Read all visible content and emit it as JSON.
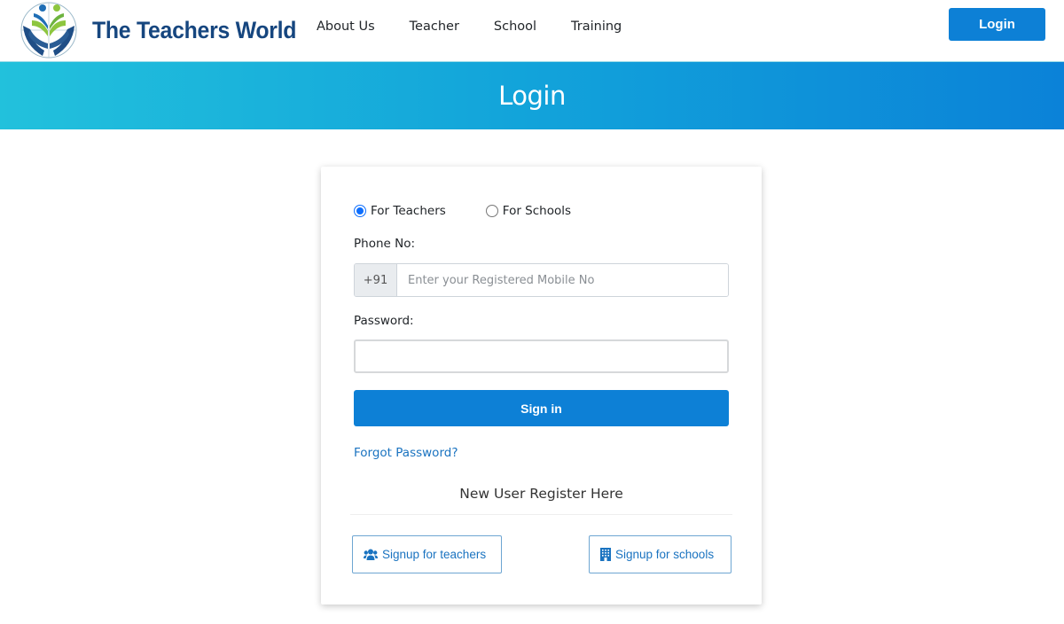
{
  "header": {
    "brand": "The Teachers World",
    "nav": [
      {
        "label": "About Us"
      },
      {
        "label": "Teacher"
      },
      {
        "label": "School"
      },
      {
        "label": "Training"
      }
    ],
    "login_label": "Login"
  },
  "banner": {
    "title": "Login"
  },
  "form": {
    "user_types": [
      {
        "label": "For Teachers",
        "checked": true
      },
      {
        "label": "For Schools",
        "checked": false
      }
    ],
    "phone_label": "Phone No:",
    "phone_prefix": "+91",
    "phone_value": "",
    "phone_placeholder": "Enter your Registered Mobile No",
    "password_label": "Password:",
    "password_value": "",
    "signin_label": "Sign in",
    "forgot_label": "Forgot Password?",
    "register_heading": "New User Register Here",
    "signup_teachers_label": "Signup for teachers",
    "signup_teachers_icon": "users-icon",
    "signup_schools_label": "Signup for schools",
    "signup_schools_icon": "building-icon"
  },
  "colors": {
    "brand_navy": "#16467f",
    "primary_blue": "#0d80d6",
    "link_blue": "#1a73c0",
    "banner_start": "#22c1dc",
    "banner_end": "#0b82d8"
  }
}
